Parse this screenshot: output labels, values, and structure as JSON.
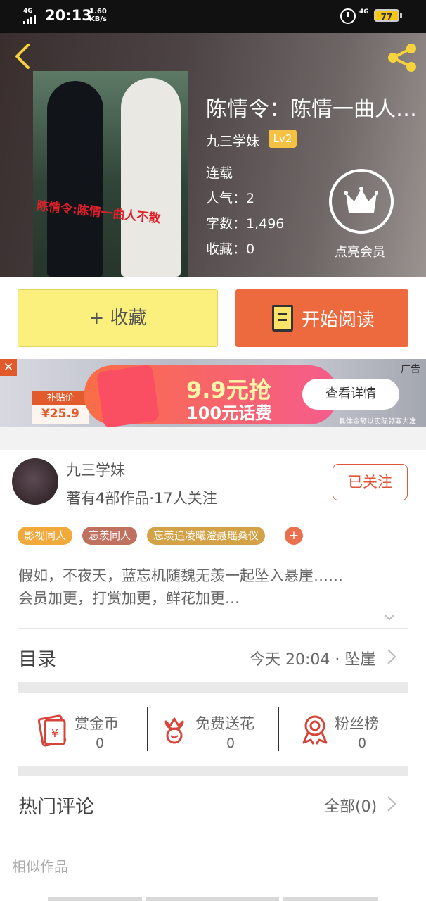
{
  "status_bar": {
    "time": "20:13",
    "net_speed_value": "1.60",
    "net_speed_unit": "KB/s",
    "signal_label": "4G",
    "network_right": "4G",
    "battery": "77"
  },
  "book": {
    "title": "陈情令：陈情一曲人…",
    "cover_text": "陈情令:陈情一曲人不散",
    "author": "九三学妹",
    "level": "Lv2",
    "status": "连载",
    "popularity": "人气：2",
    "word_count": "字数：1,496",
    "favorites": "收藏：0",
    "vip_label": "点亮会员"
  },
  "actions": {
    "collect": "+ 收藏",
    "read": "开始阅读"
  },
  "ad": {
    "close": "✕",
    "price_label": "补贴价",
    "price": "¥25.9",
    "promo_line1": "9.9元抢",
    "promo_line2": "100元话费",
    "detail_button": "查看详情",
    "ad_tag": "广告",
    "disclaimer": "具体金额以实际领取为准"
  },
  "author_card": {
    "name": "九三学妹",
    "stats": "著有4部作品·17人关注",
    "follow": "已关注"
  },
  "tags": [
    "影视同人",
    "忘羡同人",
    "忘羡追凌曦澄聂瑶桑仪"
  ],
  "tag_colors": [
    "#f0a93a",
    "#c0705e",
    "#d4a246"
  ],
  "tag_more": "+",
  "description": {
    "line1": "假如，不夜天，蓝忘机随魏无羡一起坠入悬崖……",
    "line2": "会员加更，打赏加更，鲜花加更…"
  },
  "toc": {
    "title": "目录",
    "latest": "今天 20:04 · 坠崖"
  },
  "stats": [
    {
      "name": "赏金币",
      "value": "0",
      "icon": "coin-envelope-icon"
    },
    {
      "name": "免费送花",
      "value": "0",
      "icon": "flower-icon"
    },
    {
      "name": "粉丝榜",
      "value": "0",
      "icon": "medal-icon"
    }
  ],
  "comments": {
    "title": "热门评论",
    "all": "全部(0)"
  },
  "similar": {
    "title": "相似作品"
  },
  "colors": {
    "accent": "#ec6a3e",
    "collect_bg": "#fbf07d",
    "follow": "#e0553a",
    "icon_red": "#d6453a"
  }
}
